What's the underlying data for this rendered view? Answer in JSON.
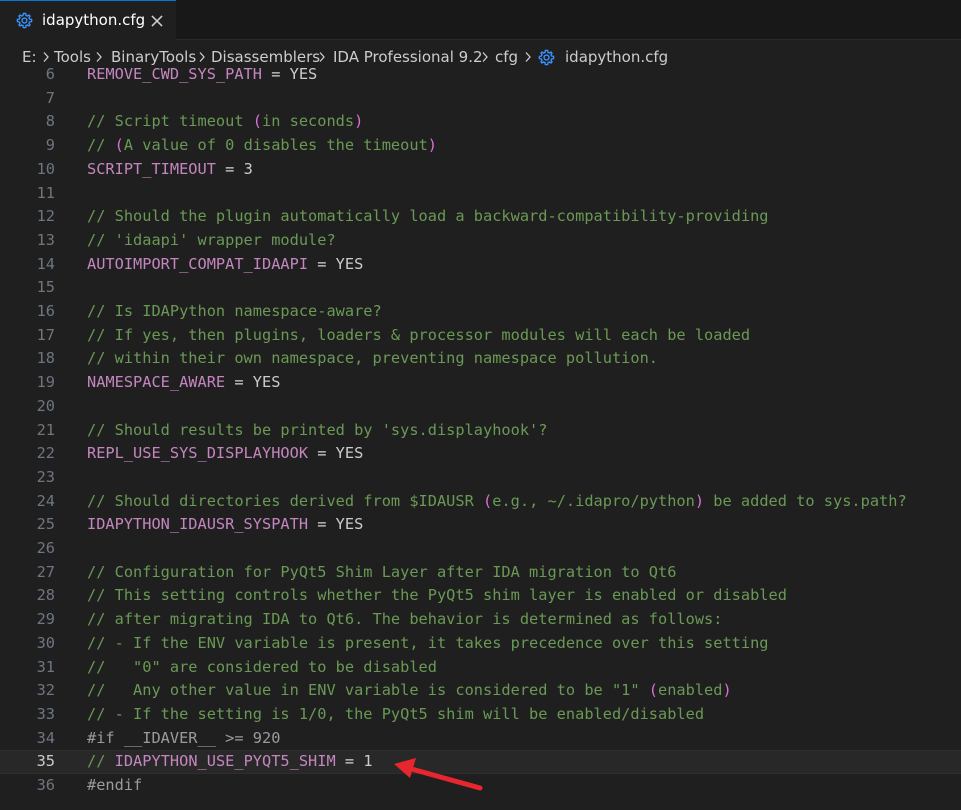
{
  "tab": {
    "title": "idapython.cfg",
    "icon": "gear-icon",
    "close_icon": "close-icon",
    "accent": "#0078d4"
  },
  "breadcrumb": {
    "items": [
      "E:",
      "Tools",
      "BinaryTools",
      "Disassemblers",
      "IDA Professional 9.2",
      "cfg",
      "idapython.cfg"
    ]
  },
  "editor": {
    "current_line": 35,
    "lines": [
      {
        "num": "6",
        "tokens": [
          {
            "t": "REMOVE_CWD_SYS_PATH",
            "k": "key"
          },
          {
            "t": " = ",
            "k": "op"
          },
          {
            "t": "YES",
            "k": "val"
          }
        ]
      },
      {
        "num": "7",
        "tokens": []
      },
      {
        "num": "8",
        "tokens": [
          {
            "t": "// Script timeout ",
            "k": "comment"
          },
          {
            "t": "(",
            "k": "paren"
          },
          {
            "t": "in seconds",
            "k": "comment"
          },
          {
            "t": ")",
            "k": "paren"
          }
        ]
      },
      {
        "num": "9",
        "tokens": [
          {
            "t": "// ",
            "k": "comment"
          },
          {
            "t": "(",
            "k": "paren"
          },
          {
            "t": "A value of 0 disables the timeout",
            "k": "comment"
          },
          {
            "t": ")",
            "k": "paren"
          }
        ]
      },
      {
        "num": "10",
        "tokens": [
          {
            "t": "SCRIPT_TIMEOUT",
            "k": "key"
          },
          {
            "t": " = ",
            "k": "op"
          },
          {
            "t": "3",
            "k": "val"
          }
        ]
      },
      {
        "num": "11",
        "tokens": []
      },
      {
        "num": "12",
        "tokens": [
          {
            "t": "// Should the plugin automatically load a backward-compatibility-providing",
            "k": "comment"
          }
        ]
      },
      {
        "num": "13",
        "tokens": [
          {
            "t": "// 'idaapi' wrapper module?",
            "k": "comment"
          }
        ]
      },
      {
        "num": "14",
        "tokens": [
          {
            "t": "AUTOIMPORT_COMPAT_IDAAPI",
            "k": "key"
          },
          {
            "t": " = ",
            "k": "op"
          },
          {
            "t": "YES",
            "k": "val"
          }
        ]
      },
      {
        "num": "15",
        "tokens": []
      },
      {
        "num": "16",
        "tokens": [
          {
            "t": "// Is IDAPython namespace-aware?",
            "k": "comment"
          }
        ]
      },
      {
        "num": "17",
        "tokens": [
          {
            "t": "// If yes, then plugins, loaders & processor modules will each be loaded",
            "k": "comment"
          }
        ]
      },
      {
        "num": "18",
        "tokens": [
          {
            "t": "// within their own namespace, preventing namespace pollution.",
            "k": "comment"
          }
        ]
      },
      {
        "num": "19",
        "tokens": [
          {
            "t": "NAMESPACE_AWARE",
            "k": "key"
          },
          {
            "t": " = ",
            "k": "op"
          },
          {
            "t": "YES",
            "k": "val"
          }
        ]
      },
      {
        "num": "20",
        "tokens": []
      },
      {
        "num": "21",
        "tokens": [
          {
            "t": "// Should results be printed by 'sys.displayhook'?",
            "k": "comment"
          }
        ]
      },
      {
        "num": "22",
        "tokens": [
          {
            "t": "REPL_USE_SYS_DISPLAYHOOK",
            "k": "key"
          },
          {
            "t": " = ",
            "k": "op"
          },
          {
            "t": "YES",
            "k": "val"
          }
        ]
      },
      {
        "num": "23",
        "tokens": []
      },
      {
        "num": "24",
        "tokens": [
          {
            "t": "// Should directories derived from $IDAUSR ",
            "k": "comment"
          },
          {
            "t": "(",
            "k": "paren"
          },
          {
            "t": "e.g., ~/.idapro/python",
            "k": "comment"
          },
          {
            "t": ")",
            "k": "paren"
          },
          {
            "t": " be added to sys.path?",
            "k": "comment"
          }
        ]
      },
      {
        "num": "25",
        "tokens": [
          {
            "t": "IDAPYTHON_IDAUSR_SYSPATH",
            "k": "key"
          },
          {
            "t": " = ",
            "k": "op"
          },
          {
            "t": "YES",
            "k": "val"
          }
        ]
      },
      {
        "num": "26",
        "tokens": []
      },
      {
        "num": "27",
        "tokens": [
          {
            "t": "// Configuration for PyQt5 Shim Layer after IDA migration to Qt6",
            "k": "comment"
          }
        ]
      },
      {
        "num": "28",
        "tokens": [
          {
            "t": "// This setting controls whether the PyQt5 shim layer is enabled or disabled",
            "k": "comment"
          }
        ]
      },
      {
        "num": "29",
        "tokens": [
          {
            "t": "// after migrating IDA to Qt6. The behavior is determined as follows:",
            "k": "comment"
          }
        ]
      },
      {
        "num": "30",
        "tokens": [
          {
            "t": "// - If the ENV variable is present, it takes precedence over this setting",
            "k": "comment"
          }
        ]
      },
      {
        "num": "31",
        "tokens": [
          {
            "t": "//   \"0\" are considered to be disabled",
            "k": "comment"
          }
        ]
      },
      {
        "num": "32",
        "tokens": [
          {
            "t": "//   Any other value in ENV variable is considered to be \"1\" ",
            "k": "comment"
          },
          {
            "t": "(",
            "k": "paren"
          },
          {
            "t": "enabled",
            "k": "comment"
          },
          {
            "t": ")",
            "k": "paren"
          }
        ]
      },
      {
        "num": "33",
        "tokens": [
          {
            "t": "// - If the setting is 1/0, the PyQt5 shim will be enabled/disabled",
            "k": "comment"
          }
        ]
      },
      {
        "num": "34",
        "tokens": [
          {
            "t": "#if __IDAVER__ >= 920",
            "k": "pre"
          }
        ]
      },
      {
        "num": "35",
        "tokens": [
          {
            "t": "// ",
            "k": "comment"
          },
          {
            "t": "IDAPYTHON_USE_PYQT5_SHIM",
            "k": "key"
          },
          {
            "t": " = ",
            "k": "op"
          },
          {
            "t": "1",
            "k": "val"
          }
        ]
      },
      {
        "num": "36",
        "tokens": [
          {
            "t": "#endif",
            "k": "pre"
          }
        ]
      }
    ]
  },
  "annotation": {
    "icon": "red-arrow-icon",
    "color": "#e8262d"
  }
}
